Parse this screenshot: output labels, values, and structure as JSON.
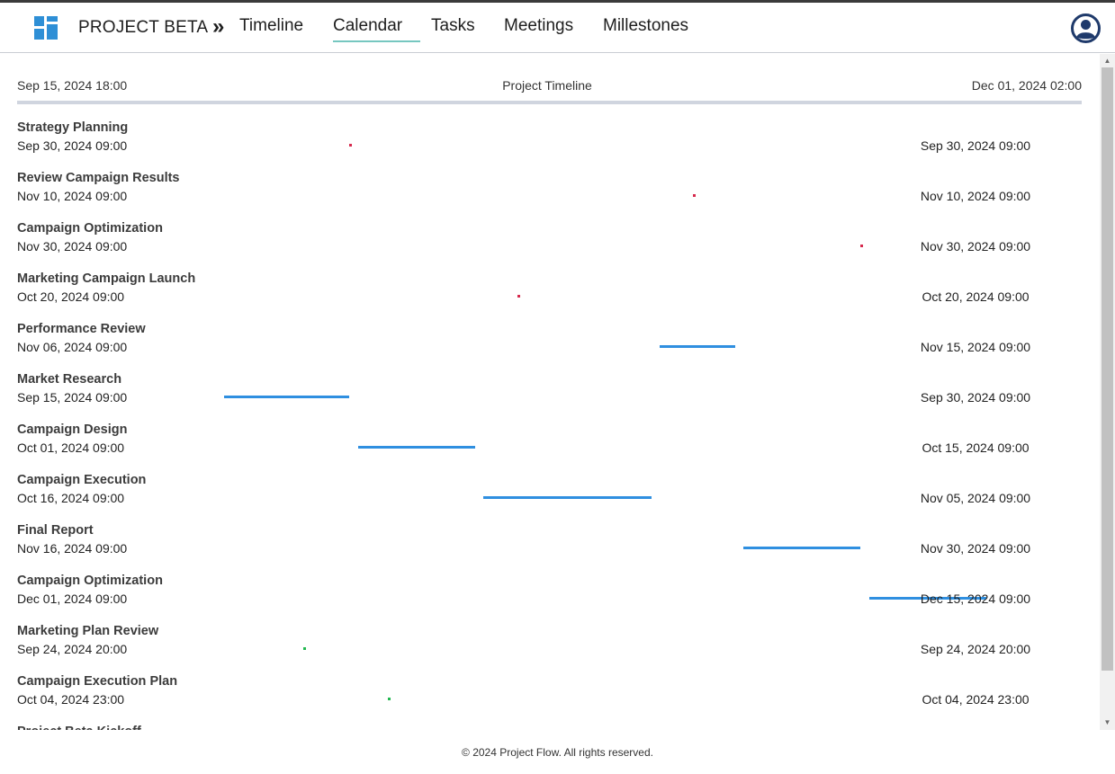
{
  "app": {
    "brand": "PROJECT BETA",
    "separator": "»",
    "nav": [
      "Timeline",
      "Calendar",
      "Tasks",
      "Meetings",
      "Millestones"
    ],
    "active_nav": "Calendar"
  },
  "timeline": {
    "start_label": "Sep 15, 2024 18:00",
    "title": "Project Timeline",
    "end_label": "Dec 01, 2024 02:00",
    "range_start": "2024-09-15T18:00",
    "range_end": "2024-12-01T02:00"
  },
  "rows": [
    {
      "name": "Strategy Planning",
      "start_text": "Sep 30, 2024 09:00",
      "end_text": "Sep 30, 2024 09:00",
      "kind": "milestone",
      "start": "2024-09-30T09:00",
      "end": "2024-09-30T09:00"
    },
    {
      "name": "Review Campaign Results",
      "start_text": "Nov 10, 2024 09:00",
      "end_text": "Nov 10, 2024 09:00",
      "kind": "milestone",
      "start": "2024-11-10T09:00",
      "end": "2024-11-10T09:00"
    },
    {
      "name": "Campaign Optimization",
      "start_text": "Nov 30, 2024 09:00",
      "end_text": "Nov 30, 2024 09:00",
      "kind": "milestone",
      "start": "2024-11-30T09:00",
      "end": "2024-11-30T09:00"
    },
    {
      "name": "Marketing Campaign Launch",
      "start_text": "Oct 20, 2024 09:00",
      "end_text": "Oct 20, 2024 09:00",
      "kind": "milestone",
      "start": "2024-10-20T09:00",
      "end": "2024-10-20T09:00"
    },
    {
      "name": "Performance Review",
      "start_text": "Nov 06, 2024 09:00",
      "end_text": "Nov 15, 2024 09:00",
      "kind": "task",
      "start": "2024-11-06T09:00",
      "end": "2024-11-15T09:00"
    },
    {
      "name": "Market Research",
      "start_text": "Sep 15, 2024 09:00",
      "end_text": "Sep 30, 2024 09:00",
      "kind": "task",
      "start": "2024-09-15T09:00",
      "end": "2024-09-30T09:00"
    },
    {
      "name": "Campaign Design",
      "start_text": "Oct 01, 2024 09:00",
      "end_text": "Oct 15, 2024 09:00",
      "kind": "task",
      "start": "2024-10-01T09:00",
      "end": "2024-10-15T09:00"
    },
    {
      "name": "Campaign Execution",
      "start_text": "Oct 16, 2024 09:00",
      "end_text": "Nov 05, 2024 09:00",
      "kind": "task",
      "start": "2024-10-16T09:00",
      "end": "2024-11-05T09:00"
    },
    {
      "name": "Final Report",
      "start_text": "Nov 16, 2024 09:00",
      "end_text": "Nov 30, 2024 09:00",
      "kind": "task",
      "start": "2024-11-16T09:00",
      "end": "2024-11-30T09:00"
    },
    {
      "name": "Campaign Optimization",
      "start_text": "Dec 01, 2024 09:00",
      "end_text": "Dec 15, 2024 09:00",
      "kind": "task",
      "start": "2024-12-01T09:00",
      "end": "2024-12-15T09:00"
    },
    {
      "name": "Marketing Plan Review",
      "start_text": "Sep 24, 2024 20:00",
      "end_text": "Sep 24, 2024 20:00",
      "kind": "meeting",
      "start": "2024-09-24T20:00",
      "end": "2024-09-24T20:00"
    },
    {
      "name": "Campaign Execution Plan",
      "start_text": "Oct 04, 2024 23:00",
      "end_text": "Oct 04, 2024 23:00",
      "kind": "meeting",
      "start": "2024-10-04T23:00",
      "end": "2024-10-04T23:00"
    },
    {
      "name": "Project Beta Kickoff",
      "start_text": "",
      "end_text": "",
      "kind": "meeting",
      "start": "",
      "end": ""
    }
  ],
  "colors": {
    "task": "#2f8fe0",
    "milestone": "#d6294d",
    "meeting": "#22b850",
    "accent": "#76c7c0",
    "brand_icon": "#2e8fd6",
    "avatar": "#1f3a6b"
  },
  "icons": {
    "logo": "grid-logo-icon",
    "avatar": "user-avatar-icon",
    "scroll_up": "triangle-up-icon",
    "scroll_down": "triangle-down-icon"
  },
  "footer": {
    "text": "© 2024 Project Flow. All rights reserved."
  }
}
